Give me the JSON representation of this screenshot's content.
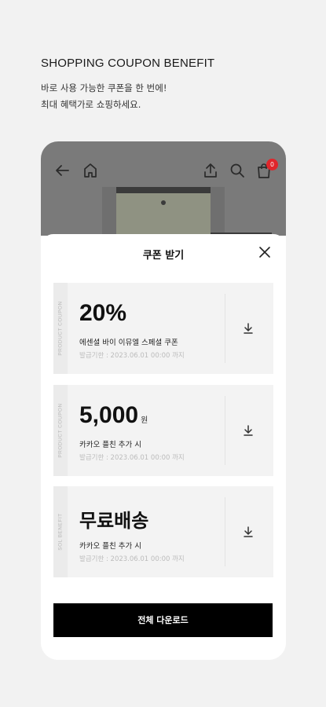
{
  "hero": {
    "title": "SHOPPING COUPON BENEFIT",
    "subtitle_line1": "바로 사용 가능한 쿠폰을 한 번에!",
    "subtitle_line2": "최대 혜택가로 쇼핑하세요."
  },
  "app_bar": {
    "cart_count": "0",
    "icons": [
      "back-arrow-icon",
      "home-icon",
      "share-icon",
      "search-icon",
      "shopping-bag-icon"
    ]
  },
  "sheet": {
    "title": "쿠폰 받기",
    "coupons": [
      {
        "side_label": "PRODUCT COUPON",
        "amount": "20%",
        "unit": "",
        "description": "에센셜 바이 이뮤엘 스페셜 쿠폰",
        "date": "발급기한 : 2023.06.01 00:00 까지"
      },
      {
        "side_label": "PRODUCT COUPON",
        "amount": "5,000",
        "unit": "원",
        "description": "카카오 플친 추가 시",
        "date": "발급기한 : 2023.06.01 00:00 까지"
      },
      {
        "side_label": "SOL BENEFIT",
        "amount": "무료배송",
        "unit": "",
        "description": "카카오 플친 추가 시",
        "date": "발급기한 : 2023.06.01 00:00 까지"
      }
    ],
    "download_all_label": "전체 다운로드"
  },
  "colors": {
    "background": "#f2f2f2",
    "overlay": "#7a7a7a",
    "badge": "#e0262b",
    "primary_button": "#000000"
  }
}
